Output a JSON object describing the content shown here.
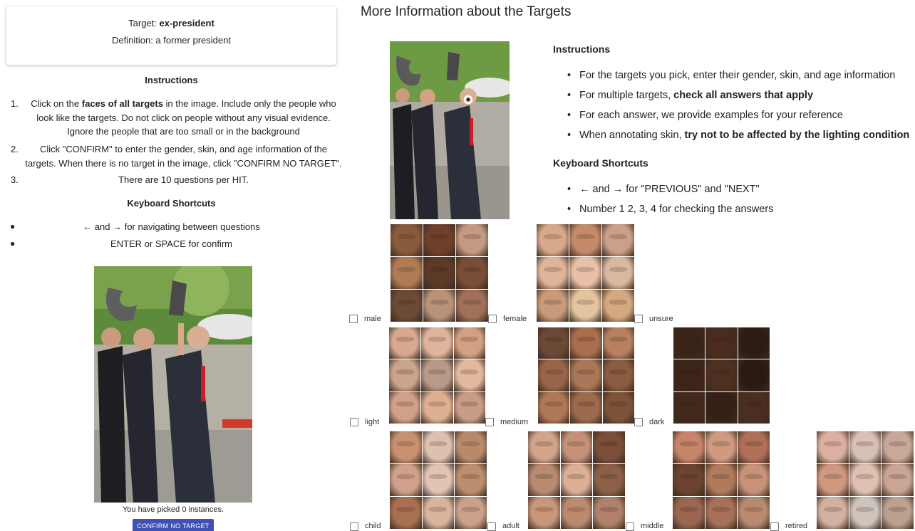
{
  "target_card": {
    "target_prefix": "Target: ",
    "target_value": "ex-president",
    "definition": "Definition: a former president"
  },
  "left": {
    "instructions_title": "Instructions",
    "instructions": [
      {
        "num": "1.",
        "pre": "Click on the ",
        "bold": "faces of all targets",
        "post": " in the image. Include only the people who look like the targets. Do not click on people without any visual evidence. Ignore the people that are too small or in the background"
      },
      {
        "num": "2.",
        "pre": "Click \"CONFIRM\" to enter the gender, skin, and age information of the targets. When there is no target in the image, click \"CONFIRM NO TARGET\".",
        "bold": "",
        "post": ""
      },
      {
        "num": "3.",
        "pre": "There are 10 questions per HIT.",
        "bold": "",
        "post": ""
      }
    ],
    "shortcuts_title": "Keyboard Shortcuts",
    "shortcuts": [
      "← and → for navigating between questions",
      "ENTER or SPACE for confirm"
    ],
    "picked_text": "You have picked 0 instances.",
    "confirm_button": "CONFIRM NO TARGET"
  },
  "right": {
    "title": "More Information about the Targets",
    "instructions_title": "Instructions",
    "bullets": [
      {
        "pre": "For the targets you pick, enter their gender, skin, and age information",
        "bold": ""
      },
      {
        "pre": "For multiple targets, ",
        "bold": "check all answers that apply"
      },
      {
        "pre": "For each answer, we provide examples for your reference",
        "bold": ""
      },
      {
        "pre": "When annotating skin, ",
        "bold": "try not to be affected by the lighting condition"
      }
    ],
    "shortcuts_title": "Keyboard Shortcuts",
    "shortcuts": [
      "← and → for \"PREVIOUS\" and \"NEXT\"",
      "Number 1 2, 3, 4 for checking the answers"
    ],
    "options": {
      "gender": [
        "male",
        "female",
        "unsure"
      ],
      "skin": [
        "light",
        "medium",
        "dark"
      ],
      "age": [
        "child",
        "adult",
        "middle",
        "retired"
      ]
    }
  },
  "colors": {
    "button_bg": "#3f51b5",
    "checkbox_border": "#777777"
  },
  "face_grids": {
    "male": [
      "#8a5a3c",
      "#6e3f2a",
      "#c49a82",
      "#b07a55",
      "#5c3a28",
      "#7a4e36",
      "#6b4a36",
      "#b8937a",
      "#a07058"
    ],
    "female": [
      "#d8a88a",
      "#c48a6a",
      "#caa08a",
      "#e0b49a",
      "#e8c0a8",
      "#d9b8a0",
      "#c89a7a",
      "#e2c49e",
      "#d4a880"
    ],
    "light": [
      "#d8a890",
      "#e0b49c",
      "#d2a084",
      "#caa48c",
      "#b89a88",
      "#e2b89e",
      "#d0a088",
      "#dcb090",
      "#c89c86"
    ],
    "medium": [
      "#6a4a36",
      "#a86e4e",
      "#b88060",
      "#9a6448",
      "#a87858",
      "#8a5c40",
      "#b07858",
      "#9c6a4c",
      "#7e5238"
    ],
    "dark": [
      "#3a2418",
      "#4a2c1e",
      "#2e1c14",
      "#3c2418",
      "#4e3020",
      "#2a1a12",
      "#43281c",
      "#362016",
      "#4a2e20"
    ],
    "child": [
      "#c89070",
      "#dcc0b0",
      "#b88a6c",
      "#d0a08a",
      "#e0c4b4",
      "#bc8e70",
      "#a87050",
      "#d8b49c",
      "#caa088"
    ],
    "adult": [
      "#d2a48a",
      "#c49078",
      "#7a4e38",
      "#b88a70",
      "#dcae94",
      "#8c6048",
      "#c8967a",
      "#bc8a6c",
      "#b08068"
    ],
    "middle": [
      "#c88468",
      "#d09a80",
      "#b07058",
      "#6a4430",
      "#b07a5c",
      "#c89278",
      "#9a6650",
      "#a87058",
      "#b88a70"
    ],
    "retired": [
      "#dcb0a0",
      "#d8c0b4",
      "#c8a898",
      "#d09880",
      "#e0c0b0",
      "#caa494",
      "#d4b0a0",
      "#cfc4bc",
      "#bca090"
    ]
  }
}
